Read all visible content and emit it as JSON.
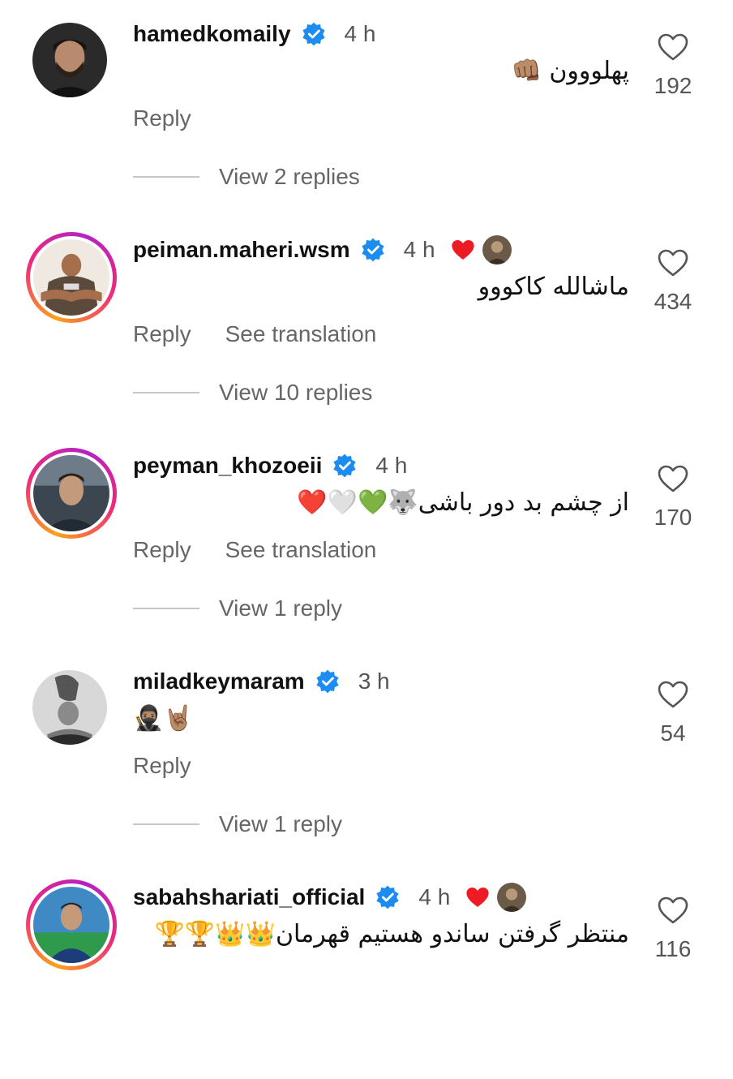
{
  "comments": [
    {
      "username": "hamedkomaily",
      "time": "4 h",
      "text": "پهلووون 👊🏽",
      "likes": "192",
      "reply_label": "Reply",
      "view_replies": "View 2 replies"
    },
    {
      "username": "peiman.maheri.wsm",
      "time": "4 h",
      "text": "ماشالله کاکووو",
      "likes": "434",
      "reply_label": "Reply",
      "translate_label": "See translation",
      "view_replies": "View 10 replies"
    },
    {
      "username": "peyman_khozoeii",
      "time": "4 h",
      "text": "از چشم بد دور باشی🐺💚🤍❤️",
      "likes": "170",
      "reply_label": "Reply",
      "translate_label": "See translation",
      "view_replies": "View 1 reply"
    },
    {
      "username": "miladkeymaram",
      "time": "3 h",
      "text": "🥷🏽🤘🏽",
      "likes": "54",
      "reply_label": "Reply",
      "view_replies": "View 1 reply"
    },
    {
      "username": "sabahshariati_official",
      "time": "4 h",
      "text": "منتظر گرفتن ساندو هستیم قهرمان👑👑🏆🏆",
      "likes": "116"
    }
  ],
  "icons": {
    "verified": "verified-badge-icon",
    "like": "heart-outline-icon",
    "creator_liked": "red-heart-icon"
  },
  "colors": {
    "verified_blue": "#1d8cf0",
    "heart_red": "#ed1c24",
    "muted_text": "#666666"
  }
}
